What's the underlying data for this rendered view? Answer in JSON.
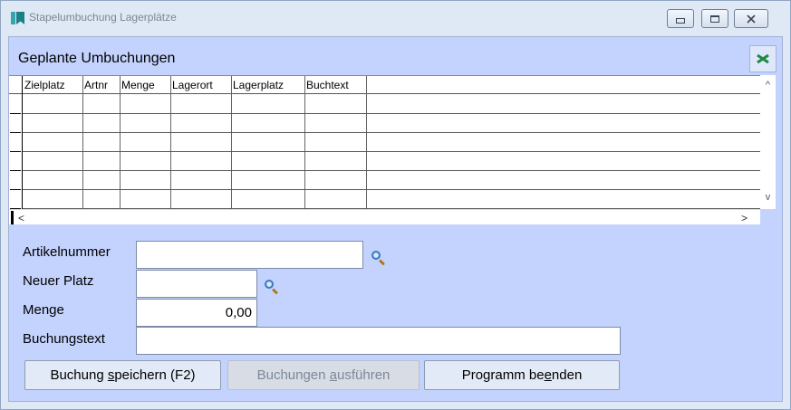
{
  "window": {
    "title": "Stapelumbuchung Lagerplätze",
    "controls": {
      "minimize": "minimize-icon",
      "maximize": "maximize-icon",
      "close": "close-icon"
    }
  },
  "section": {
    "title": "Geplante Umbuchungen",
    "export_icon": "excel-icon"
  },
  "grid": {
    "columns": [
      "Zielplatz",
      "Artnr",
      "Menge",
      "Lagerort",
      "Lagerplatz",
      "Buchtext"
    ],
    "rows": [],
    "vscroll": {
      "up": "^",
      "down": "v"
    },
    "hscroll": {
      "left": "<",
      "right": ">"
    }
  },
  "form": {
    "artikelnummer": {
      "label": "Artikelnummer",
      "value": ""
    },
    "neuer_platz": {
      "label": "Neuer Platz",
      "value": ""
    },
    "menge": {
      "label": "Menge",
      "value": "0,00"
    },
    "buchungstext": {
      "label": "Buchungstext",
      "value": ""
    }
  },
  "buttons": {
    "save": {
      "pre": "Buchung ",
      "mn": "s",
      "post": "peichern (F2)"
    },
    "execute": {
      "pre": "Buchungen ",
      "mn": "a",
      "post": "usführen",
      "disabled": true
    },
    "quit": {
      "pre": "Programm be",
      "mn": "e",
      "post": "nden"
    }
  },
  "colors": {
    "panel": "#c4d3fe",
    "window": "#dfe9f6",
    "grid": "#ffffff"
  }
}
